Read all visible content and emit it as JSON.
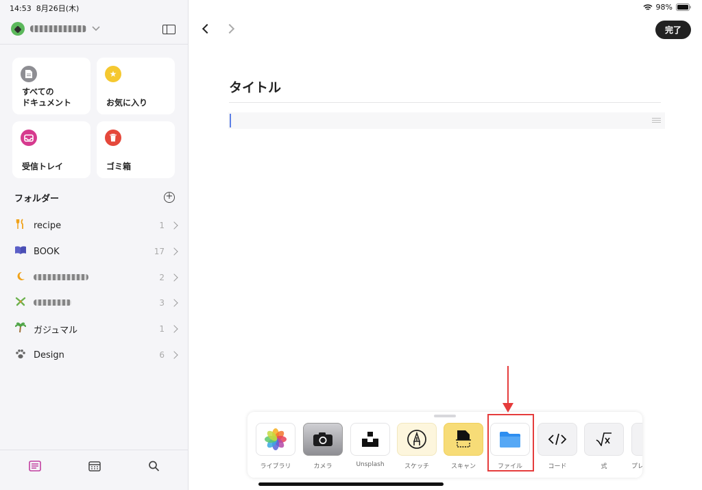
{
  "status": {
    "time": "14:53",
    "date": "8月26日(木)",
    "battery": "98%"
  },
  "sidebar": {
    "cards": [
      {
        "label": "すべての\nドキュメント",
        "icon": "document-icon",
        "color": "#8e8e93",
        "glyph": "▤"
      },
      {
        "label": "お気に入り",
        "icon": "star-icon",
        "color": "#f5c830",
        "glyph": "★"
      },
      {
        "label": "受信トレイ",
        "icon": "inbox-icon",
        "color": "#d63a8e",
        "glyph": "⌂"
      },
      {
        "label": "ゴミ箱",
        "icon": "trash-icon",
        "color": "#e5483b",
        "glyph": "▥"
      }
    ],
    "folders_title": "フォルダー",
    "add_glyph": "+",
    "folders": [
      {
        "name": "recipe",
        "count": "1",
        "icon": "fork-knife-icon",
        "glyph": "🍴"
      },
      {
        "name": "BOOK",
        "count": "17",
        "icon": "book-icon",
        "glyph": "📘"
      },
      {
        "name": "",
        "count": "2",
        "icon": "moon-icon",
        "glyph": "🌙",
        "redacted": true
      },
      {
        "name": "",
        "count": "3",
        "icon": "palm-leaf-icon",
        "glyph": "✦",
        "redacted": true
      },
      {
        "name": "ガジュマル",
        "count": "1",
        "icon": "palm-tree-icon",
        "glyph": "🌴"
      },
      {
        "name": "Design",
        "count": "6",
        "icon": "paw-icon",
        "glyph": "🐾"
      }
    ]
  },
  "header": {
    "done_label": "完了"
  },
  "document": {
    "title": "タイトル"
  },
  "insert_panel": {
    "tools": [
      {
        "name": "ライブラリ",
        "icon": "photos-icon"
      },
      {
        "name": "カメラ",
        "icon": "camera-icon"
      },
      {
        "name": "Unsplash",
        "icon": "unsplash-icon"
      },
      {
        "name": "スケッチ",
        "icon": "sketch-pen-icon"
      },
      {
        "name": "スキャン",
        "icon": "scan-icon"
      },
      {
        "name": "ファイル",
        "icon": "folder-icon"
      },
      {
        "name": "コード",
        "icon": "code-icon"
      },
      {
        "name": "式",
        "icon": "formula-icon"
      },
      {
        "name": "プレ",
        "icon": "more-icon"
      }
    ]
  },
  "colors": {
    "annotation": "#e53b3b",
    "accent": "#5b7ee5"
  }
}
